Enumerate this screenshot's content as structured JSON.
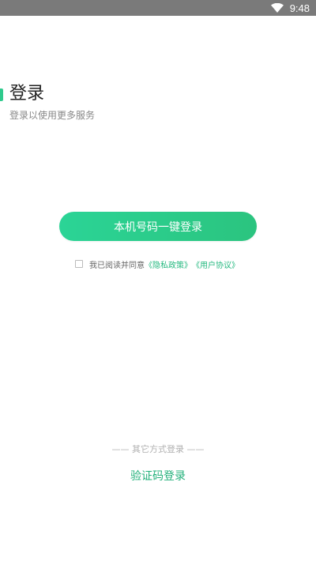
{
  "status_bar": {
    "time": "9:48",
    "icons": [
      "wifi-icon"
    ],
    "background": "#7a7a7a"
  },
  "header": {
    "title": "登录",
    "subtitle": "登录以使用更多服务",
    "accent_color": "#2fca8d"
  },
  "login": {
    "one_click_label": "本机号码一键登录",
    "button_gradient": [
      "#2bd496",
      "#2bc47f"
    ]
  },
  "agreement": {
    "checked": false,
    "text": "我已阅读并同意",
    "privacy_link": "《隐私政策》",
    "terms_link": "《用户协议》",
    "link_color": "#26b980"
  },
  "alt_login": {
    "divider_text": "—— 其它方式登录 ——",
    "sms_label": "验证码登录",
    "sms_color": "#22b07a"
  }
}
